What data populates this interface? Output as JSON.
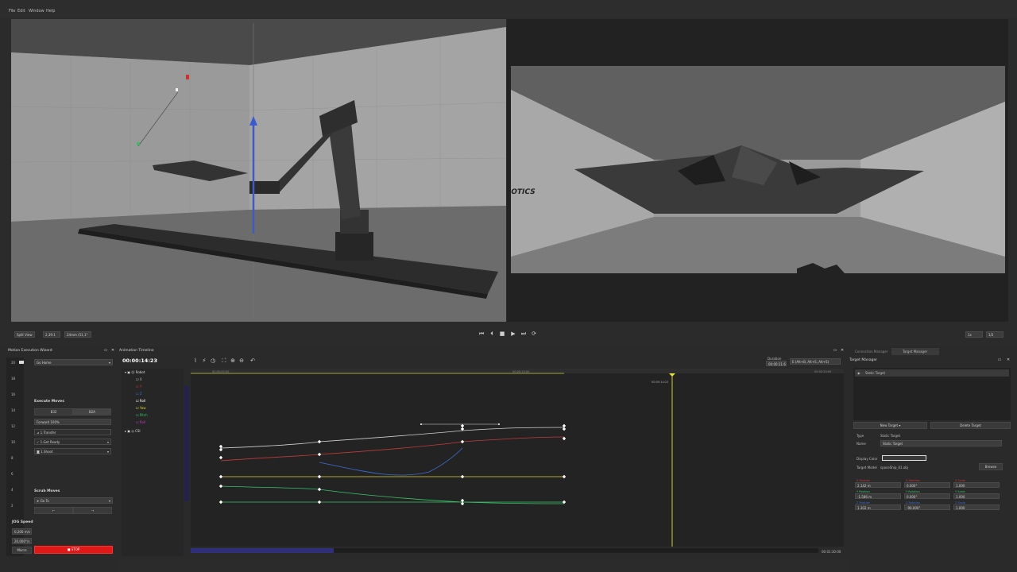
{
  "menu": [
    "File",
    "Edit",
    "Window",
    "Help"
  ],
  "viewport_bar": {
    "view_mode": "Split View",
    "ratio": "2,39:1",
    "lens": "24mm (51,1°",
    "speed": "1x",
    "fraction": "1/2"
  },
  "camera_view": {
    "logo_text": "OTICS"
  },
  "wizard": {
    "title": "Motion Execution Wizard",
    "ruler": [
      "20",
      "18",
      "16",
      "14",
      "12",
      "10",
      "8",
      "6",
      "4",
      "2"
    ],
    "home_select": "Go Home",
    "execute_label": "Execute Moves",
    "seg_left": "B32",
    "seg_right": "B2A",
    "forward_select": "Forward 100%",
    "moves": [
      "1.Transfer",
      "1.Get Ready",
      "1.Shoot"
    ],
    "scrub_label": "Scrub Moves",
    "goto_select": "Go To",
    "prev_arrow": "←",
    "next_arrow": "→",
    "jog_label": "JOG Speed",
    "jog_speed_1": "0,200 m/s",
    "jog_speed_2": "20,000°/s",
    "macro_label": "Macro",
    "stop_label": "STOP"
  },
  "timeline": {
    "title": "Animation Timeline",
    "current_time": "00:00:14:23",
    "duration_label": "Duration",
    "duration_value": "00:00:11:69",
    "interp_select": "E (Alt+B, Alt+S, Alt+S)",
    "ruler_marks": [
      "00:00:00:00",
      "00:00:10:00",
      "00:00:20:00"
    ],
    "playhead_label": "00:00:14:22",
    "end_time": "00:01:30:00",
    "tree_root": "Robot",
    "tree_items": [
      "X",
      "Y",
      "Z",
      "Roll",
      "Yaw",
      "Pitch",
      "Roll"
    ],
    "tree_extra": "CSI",
    "colors": {
      "x": "#d0d0d0",
      "y": "#c23b3b",
      "z": "#3d6fd6",
      "roll": "#ffffff",
      "yaw": "#e0d23a",
      "pitch": "#3bc26a",
      "roll2": "#c23bc2"
    }
  },
  "target_manager": {
    "tab_inactive": "Connection Manager",
    "tab_active": "Target Manager",
    "title": "Target Manager",
    "list_item": "Static Target",
    "new_button": "New Target",
    "delete_button": "Delete Target",
    "type_label": "Type",
    "type_value": "Static Target",
    "name_label": "Name",
    "name_value": "Static Target",
    "display_color_label": "Display Color",
    "target_model_label": "Target Model",
    "target_model_value": "spaceShip_01.obj",
    "browse_button": "Browse",
    "grid": [
      [
        "X Position",
        "2,142 m",
        "X Rotation",
        "0,000°",
        "X Scale",
        "1,000"
      ],
      [
        "Y Position",
        "-1,586 m",
        "Y Rotation",
        "0,000°",
        "Y Scale",
        "1,000"
      ],
      [
        "Z Position",
        "1,302 m",
        "Z Rotation",
        "-90,000°",
        "Z Scale",
        "1,000"
      ]
    ],
    "grid_label_colors": [
      "#c23b3b",
      "#3bc26a",
      "#3d6fd6"
    ]
  }
}
